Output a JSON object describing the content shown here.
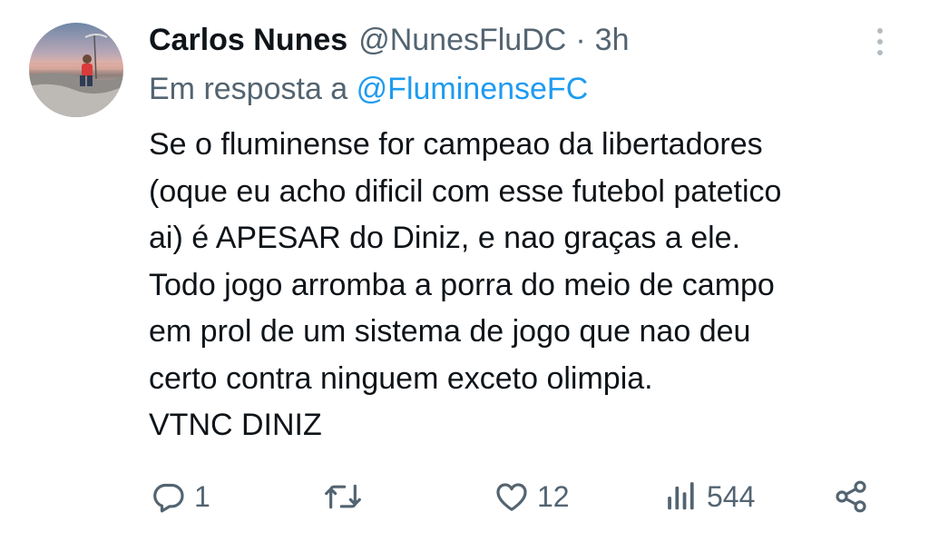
{
  "tweet": {
    "author_name": "Carlos Nunes",
    "author_handle": "@NunesFluDC",
    "separator": "·",
    "time": "3h",
    "reply_prefix": "Em resposta a",
    "reply_mention": "@FluminenseFC",
    "body_lines": [
      "Se o fluminense for campeao da libertadores",
      "(oque eu acho dificil com esse futebol patetico",
      "ai) é APESAR do Diniz, e nao graças a ele.",
      "Todo jogo arromba a porra do meio de campo",
      "em prol de um sistema de jogo que nao deu",
      "certo contra ninguem exceto olimpia.",
      "VTNC DINIZ"
    ]
  },
  "actions": {
    "reply_count": "1",
    "retweet_count": "",
    "like_count": "12",
    "views_count": "544"
  },
  "icons": {
    "more": "more-vertical-icon",
    "reply": "reply-icon",
    "retweet": "retweet-icon",
    "like": "heart-icon",
    "views": "views-icon",
    "share": "share-icon"
  },
  "colors": {
    "text_primary": "#0f1419",
    "text_secondary": "#536471",
    "link": "#1d9bf0",
    "icon": "#536471"
  }
}
